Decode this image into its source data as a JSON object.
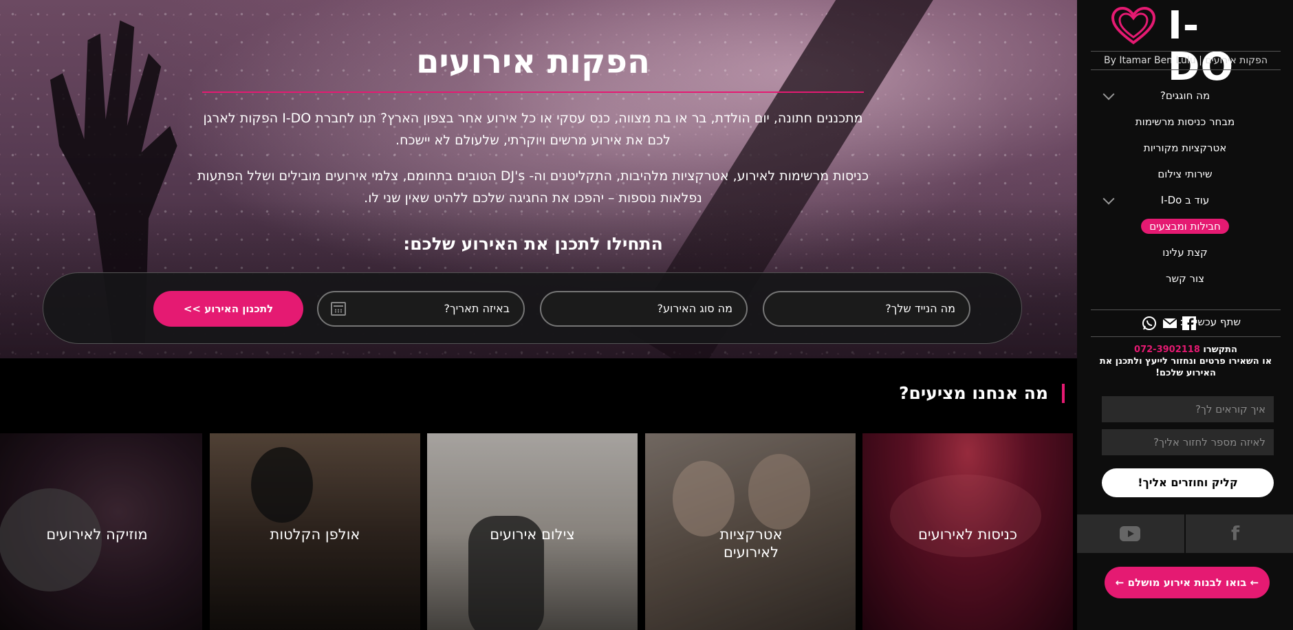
{
  "hero": {
    "title": "הפקות אירועים",
    "para1": "מתכננים חתונה, יום הולדת, בר או בת מצווה, כנס עסקי או כל אירוע אחר בצפון הארץ? תנו לחברת I-DO הפקות לארגן לכם את אירוע מרשים ויוקרתי, שלעולם לא יישכח.",
    "para2": "כניסות מרשימות לאירוע, אטרקציות מלהיבות, התקליטנים וה- DJ's הטובים בתחומם, צלמי אירועים מובילים ושלל הפתעות נפלאות נוספות – יהפכו את החגיגה שלכם ללהיט שאין שני לו.",
    "subtitle": "התחילו לתכנן את האירוע שלכם:"
  },
  "form": {
    "guests_placeholder": "מה הנייד שלך?",
    "type_placeholder": "מה סוג האירוע?",
    "date_placeholder": "באיזה תאריך?",
    "submit_label": "לתכנון האירוע >>"
  },
  "services": {
    "heading": "מה אנחנו מציעים?",
    "cards": [
      {
        "label": "כניסות לאירועים"
      },
      {
        "label": "אטרקציות לאירועים"
      },
      {
        "label": "צילום אירועים"
      },
      {
        "label": "אולפן הקלטות"
      },
      {
        "label": "מוזיקה לאירועים"
      }
    ]
  },
  "sidebar": {
    "logo_text": "I-DO",
    "tagline": "By Itamar Ben Lulu | הפקות אירועים",
    "nav": [
      {
        "label": "מה חוגגים?",
        "has_dropdown": true
      },
      {
        "label": "מבחר כניסות מרשימות"
      },
      {
        "label": "אטרקציות מקוריות"
      },
      {
        "label": "שירותי צילום"
      },
      {
        "label": "עוד ב I-Do",
        "has_dropdown": true
      },
      {
        "label": "חבילות ומבצעים",
        "active": true
      },
      {
        "label": "קצת עלינו"
      },
      {
        "label": "צור קשר"
      }
    ],
    "share_label": "שתף עכשיו ב:",
    "contact_prefix": "התקשרו",
    "contact_phone": "072-3902118",
    "contact_text": "או השאירו פרטים ונחזור לייעץ ולתכנן את האירוע שלכם!",
    "name_placeholder": "איך קוראים לך?",
    "phone_placeholder": "לאיזה מספר לחזור אליך?",
    "callback_label": "קליק וחוזרים אליך!",
    "cta_label": "← בואו לבנות אירוע מושלם ←"
  },
  "colors": {
    "accent": "#e51a72",
    "sidebar_bg": "#0d0d0d",
    "form_bg": "#1b1b1b"
  }
}
